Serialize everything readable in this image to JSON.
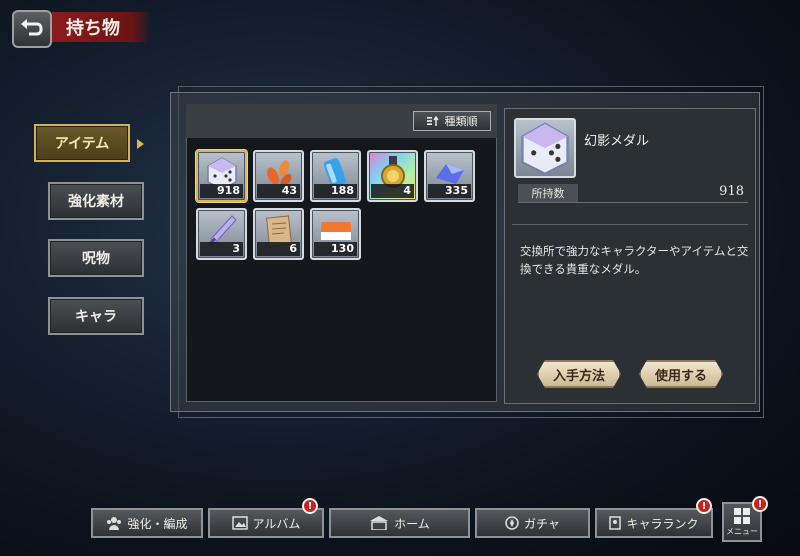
{
  "header": {
    "title": "持ち物",
    "back_icon": "back-arrow-icon"
  },
  "side_tabs": [
    {
      "label": "アイテム",
      "active": true
    },
    {
      "label": "強化素材",
      "active": false
    },
    {
      "label": "呪物",
      "active": false
    },
    {
      "label": "キャラ",
      "active": false
    }
  ],
  "sort": {
    "label": "種類順",
    "icon": "sort-icon"
  },
  "items": [
    {
      "icon": "phantom-medal-icon",
      "count": "918",
      "selected": true
    },
    {
      "icon": "orange-leaves-icon",
      "count": "43"
    },
    {
      "icon": "blue-canister-icon",
      "count": "188"
    },
    {
      "icon": "gold-medal-icon",
      "count": "4",
      "rainbow": true
    },
    {
      "icon": "blue-crystal-icon",
      "count": "335"
    },
    {
      "icon": "crystal-sword-icon",
      "count": "3"
    },
    {
      "icon": "old-scroll-icon",
      "count": "6"
    },
    {
      "icon": "orange-ticket-icon",
      "count": "130"
    }
  ],
  "detail": {
    "name": "幻影メダル",
    "quantity_label": "所持数",
    "quantity": "918",
    "description": "交換所で強力なキャラクターやアイテムと交換できる貴重なメダル。",
    "obtain_label": "入手方法",
    "use_label": "使用する"
  },
  "bottom_nav": [
    {
      "label": "強化・編成",
      "icon": "party-icon",
      "badge": false
    },
    {
      "label": "アルバム",
      "icon": "album-icon",
      "badge": true
    },
    {
      "label": "ホーム",
      "icon": "home-icon",
      "badge": false
    },
    {
      "label": "ガチャ",
      "icon": "gacha-icon",
      "badge": false
    },
    {
      "label": "キャラランク",
      "icon": "character-rank-icon",
      "badge": true
    }
  ],
  "menu": {
    "label": "メニュー",
    "badge": true
  },
  "badge_text": "!",
  "colors": {
    "accent_gold": "#d5b25a",
    "title_red": "#8a1d1d",
    "badge_red": "#c8221e"
  }
}
